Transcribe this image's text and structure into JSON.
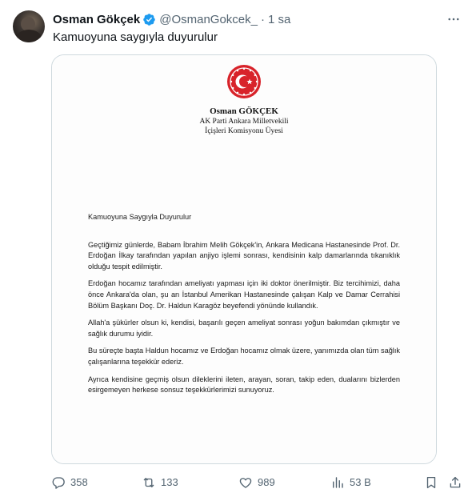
{
  "author": {
    "display_name": "Osman Gökçek",
    "handle": "@OsmanGokcek_",
    "separator": "·",
    "time": "1 sa",
    "verified_icon": "verified-badge-icon"
  },
  "tweet": {
    "text": "Kamuoyuna saygıyla duyurulur"
  },
  "document": {
    "seal_icon": "tbmm-seal-icon",
    "letterhead": {
      "name": "Osman GÖKÇEK",
      "line1": "AK Parti Ankara Milletvekili",
      "line2": "İçişleri Komisyonu Üyesi"
    },
    "greeting": "Kamuoyuna Saygıyla Duyurulur",
    "paragraphs": [
      "Geçtiğimiz günlerde, Babam İbrahim Melih Gökçek'in, Ankara Medicana Hastanesinde Prof. Dr. Erdoğan İlkay tarafından yapılan anjiyo işlemi sonrası, kendisinin kalp damarlarında tıkanıklık olduğu tespit edilmiştir.",
      "Erdoğan hocamız tarafından ameliyatı yapması için iki doktor önerilmiştir. Biz tercihimizi, daha önce Ankara'da olan, şu an İstanbul Amerikan Hastanesinde çalışan Kalp ve Damar Cerrahisi Bölüm Başkanı Doç. Dr. Haldun Karagöz beyefendi yönünde kullandık.",
      "Allah'a şükürler olsun ki, kendisi, başarılı geçen ameliyat sonrası yoğun bakımdan çıkmıştır ve sağlık durumu iyidir.",
      "Bu süreçte başta Haldun hocamız ve Erdoğan hocamız olmak üzere, yanımızda olan tüm sağlık çalışanlarına teşekkür ederiz.",
      "Ayrıca kendisine geçmiş olsun dileklerini ileten, arayan, soran, takip eden, dualarını bizlerden esirgemeyen herkese sonsuz teşekkürlerimizi sunuyoruz."
    ]
  },
  "actions": {
    "replies": "358",
    "reposts": "133",
    "likes": "989",
    "views": "53 B"
  },
  "colors": {
    "verified": "#1d9bf0",
    "muted": "#536471",
    "seal_red": "#d8232a",
    "border": "#cfd9de"
  }
}
